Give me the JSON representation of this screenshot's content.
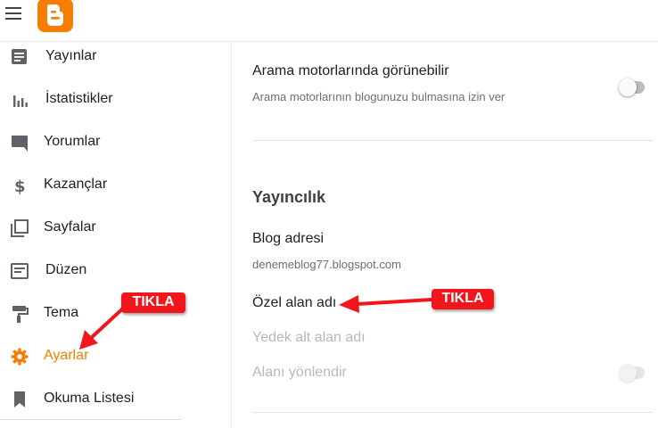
{
  "nav": {
    "items": [
      {
        "label": "Yayınlar",
        "icon": "posts-icon"
      },
      {
        "label": "İstatistikler",
        "icon": "stats-icon"
      },
      {
        "label": "Yorumlar",
        "icon": "comments-icon"
      },
      {
        "label": "Kazançlar",
        "icon": "dollar-icon"
      },
      {
        "label": "Sayfalar",
        "icon": "pages-icon"
      },
      {
        "label": "Düzen",
        "icon": "layout-icon"
      },
      {
        "label": "Tema",
        "icon": "paint-roller-icon"
      },
      {
        "label": "Ayarlar",
        "icon": "gear-icon",
        "active": true
      },
      {
        "label": "Okuma Listesi",
        "icon": "bookmark-icon"
      }
    ]
  },
  "settings": {
    "search_visibility": {
      "title": "Arama motorlarında görünebilir",
      "description": "Arama motorlarının blogunuzu bulmasına izin ver",
      "enabled": false
    },
    "publishing": {
      "section_title": "Yayıncılık",
      "blog_address_title": "Blog adresi",
      "blog_address_value": "denemeblog77.blogspot.com",
      "custom_domain_title": "Özel alan adı",
      "fallback_subdomain_title": "Yedek alt alan adı",
      "redirect_domain_title": "Alanı yönlendir",
      "redirect_enabled": false
    }
  },
  "annotations": {
    "sidebar_label": "TIKLA",
    "main_label": "TIKLA"
  },
  "colors": {
    "brand": "#f57d00",
    "annotation": "#f2161c"
  }
}
